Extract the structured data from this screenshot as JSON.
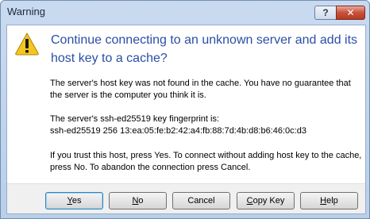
{
  "window": {
    "title": "Warning"
  },
  "titlebar": {
    "help_label": "?",
    "close_label": "✕"
  },
  "icons": {
    "warning": "warning-triangle-icon",
    "help": "question-icon",
    "close": "close-icon"
  },
  "colors": {
    "heading": "#2a4ea6",
    "warning_fill": "#f5c620",
    "close_button": "#c9503a"
  },
  "dialog": {
    "heading": "Continue connecting to an unknown server and add its host key to a cache?",
    "message1": "The server's host key was not found in the cache. You have no guarantee that the server is the computer you think it is.",
    "message2_line1": "The server's ssh-ed25519 key fingerprint is:",
    "message2_line2": "ssh-ed25519 256 13:ea:05:fe:b2:42:a4:fb:88:7d:4b:d8:b6:46:0c:d3",
    "message3": "If you trust this host, press Yes. To connect without adding host key to the cache, press No. To abandon the connection press Cancel."
  },
  "buttons": {
    "yes": {
      "accel": "Y",
      "rest": "es"
    },
    "no": {
      "accel": "N",
      "rest": "o"
    },
    "cancel": {
      "label": "Cancel"
    },
    "copy_key": {
      "accel": "C",
      "rest": "opy Key"
    },
    "help": {
      "accel": "H",
      "rest": "elp"
    }
  }
}
